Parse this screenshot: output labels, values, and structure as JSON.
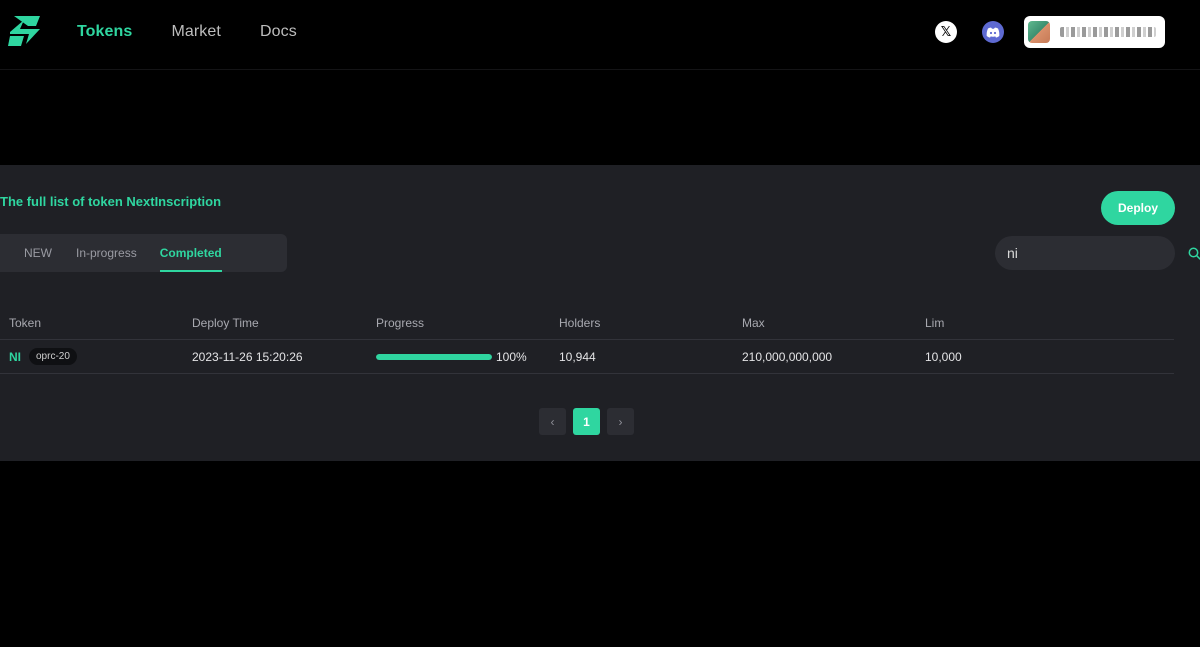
{
  "header": {
    "nav": [
      {
        "label": "Tokens",
        "active": true
      },
      {
        "label": "Market",
        "active": false
      },
      {
        "label": "Docs",
        "active": false
      }
    ],
    "social": {
      "x_icon": "x-icon",
      "discord_icon": "discord-icon"
    },
    "wallet": {
      "avatar_icon": "avatar",
      "address": "(obscured)"
    }
  },
  "panel": {
    "title": "The full list of token NextInscription",
    "deploy_label": "Deploy",
    "tabs": [
      {
        "label": "NEW",
        "active": false
      },
      {
        "label": "In-progress",
        "active": false
      },
      {
        "label": "Completed",
        "active": true
      }
    ],
    "search": {
      "value": "ni",
      "placeholder": ""
    }
  },
  "table": {
    "headers": [
      "Token",
      "Deploy Time",
      "Progress",
      "Holders",
      "Max",
      "Lim"
    ],
    "rows": [
      {
        "token": "NI",
        "tag": "oprc-20",
        "deploy_time": "2023-11-26 15:20:26",
        "progress": 1.0,
        "progress_label": "100%",
        "holders": "10,944",
        "max": "210,000,000,000",
        "lim": "10,000"
      }
    ]
  },
  "pagination": {
    "prev": "‹",
    "current": "1",
    "next": "›"
  },
  "colors": {
    "accent": "#2fd6a0",
    "panel_bg": "#1f2025",
    "page_bg": "#000000"
  }
}
